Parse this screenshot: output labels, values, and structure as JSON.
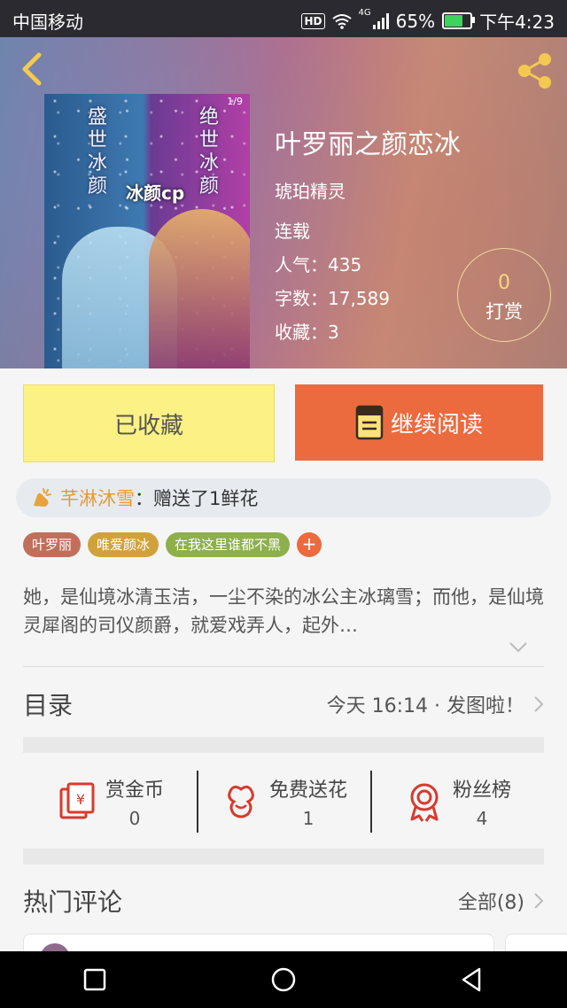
{
  "status_bar": {
    "carrier": "中国移动",
    "hd": "HD",
    "network": "4G",
    "battery": "65%",
    "battery_level": 0.65,
    "time": "下午4:23"
  },
  "book": {
    "cover_text_left": "盛世冰颜",
    "cover_text_right": "绝世冰颜",
    "cover_text_middle": "冰颜cp",
    "cover_page": "1/9",
    "title": "叶罗丽之颜恋冰",
    "author": "琥珀精灵",
    "status": "连载",
    "popularity": "人气：435",
    "word_count": "字数：17,589",
    "favorites": "收藏：3"
  },
  "reward": {
    "count": "0",
    "label": "打赏"
  },
  "actions": {
    "favorited_label": "已收藏",
    "continue_label": "继续阅读"
  },
  "gift": {
    "user": "芊淋沐雪",
    "message": "：赠送了1鲜花"
  },
  "tags": [
    {
      "label": "叶罗丽",
      "color": "#c0705a"
    },
    {
      "label": "唯爱颜冰",
      "color": "#d1a23c"
    },
    {
      "label": "在我这里谁都不黑",
      "color": "#8db04b"
    }
  ],
  "tag_add": "+",
  "description": "她，是仙境冰清玉洁，一尘不染的冰公主冰璃雪；而他，是仙境灵犀阁的司仪颜爵，就爱戏弄人，起外…",
  "catalog": {
    "title": "目录",
    "latest": "今天 16:14 · 发图啦！"
  },
  "stats": [
    {
      "label": "赏金币",
      "value": "0",
      "icon": "red-envelope-icon"
    },
    {
      "label": "免费送花",
      "value": "1",
      "icon": "flower-icon"
    },
    {
      "label": "粉丝榜",
      "value": "4",
      "icon": "medal-icon"
    }
  ],
  "comments": {
    "title": "热门评论",
    "all": "全部(8)"
  },
  "colors": {
    "accent": "#eb6b3e",
    "favorite_bg": "#fbf184",
    "gift_user": "#e59a3a",
    "icon_red": "#d9392c"
  }
}
